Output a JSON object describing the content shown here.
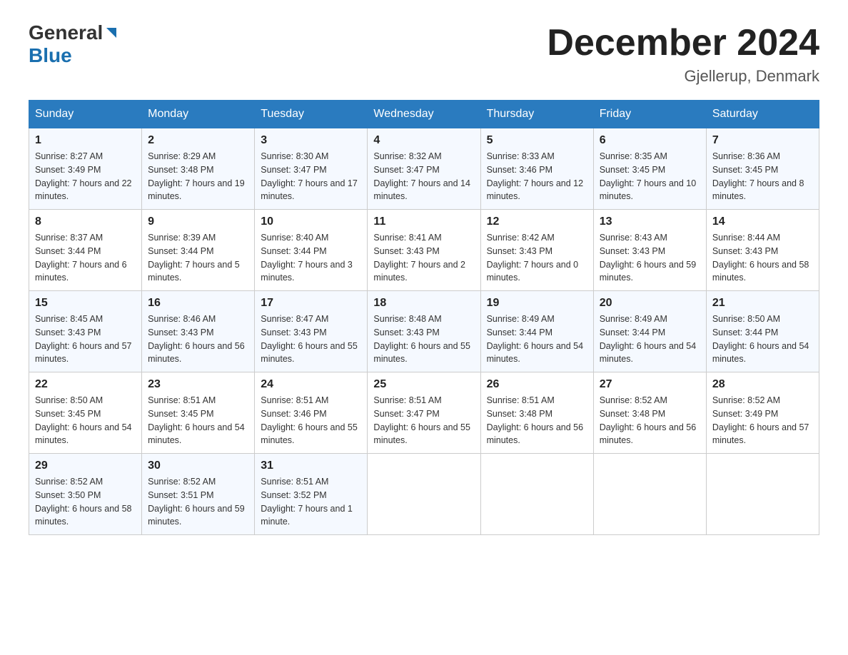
{
  "logo": {
    "general": "General",
    "blue": "Blue"
  },
  "header": {
    "title": "December 2024",
    "subtitle": "Gjellerup, Denmark"
  },
  "days_of_week": [
    "Sunday",
    "Monday",
    "Tuesday",
    "Wednesday",
    "Thursday",
    "Friday",
    "Saturday"
  ],
  "weeks": [
    [
      {
        "day": "1",
        "sunrise": "8:27 AM",
        "sunset": "3:49 PM",
        "daylight": "7 hours and 22 minutes."
      },
      {
        "day": "2",
        "sunrise": "8:29 AM",
        "sunset": "3:48 PM",
        "daylight": "7 hours and 19 minutes."
      },
      {
        "day": "3",
        "sunrise": "8:30 AM",
        "sunset": "3:47 PM",
        "daylight": "7 hours and 17 minutes."
      },
      {
        "day": "4",
        "sunrise": "8:32 AM",
        "sunset": "3:47 PM",
        "daylight": "7 hours and 14 minutes."
      },
      {
        "day": "5",
        "sunrise": "8:33 AM",
        "sunset": "3:46 PM",
        "daylight": "7 hours and 12 minutes."
      },
      {
        "day": "6",
        "sunrise": "8:35 AM",
        "sunset": "3:45 PM",
        "daylight": "7 hours and 10 minutes."
      },
      {
        "day": "7",
        "sunrise": "8:36 AM",
        "sunset": "3:45 PM",
        "daylight": "7 hours and 8 minutes."
      }
    ],
    [
      {
        "day": "8",
        "sunrise": "8:37 AM",
        "sunset": "3:44 PM",
        "daylight": "7 hours and 6 minutes."
      },
      {
        "day": "9",
        "sunrise": "8:39 AM",
        "sunset": "3:44 PM",
        "daylight": "7 hours and 5 minutes."
      },
      {
        "day": "10",
        "sunrise": "8:40 AM",
        "sunset": "3:44 PM",
        "daylight": "7 hours and 3 minutes."
      },
      {
        "day": "11",
        "sunrise": "8:41 AM",
        "sunset": "3:43 PM",
        "daylight": "7 hours and 2 minutes."
      },
      {
        "day": "12",
        "sunrise": "8:42 AM",
        "sunset": "3:43 PM",
        "daylight": "7 hours and 0 minutes."
      },
      {
        "day": "13",
        "sunrise": "8:43 AM",
        "sunset": "3:43 PM",
        "daylight": "6 hours and 59 minutes."
      },
      {
        "day": "14",
        "sunrise": "8:44 AM",
        "sunset": "3:43 PM",
        "daylight": "6 hours and 58 minutes."
      }
    ],
    [
      {
        "day": "15",
        "sunrise": "8:45 AM",
        "sunset": "3:43 PM",
        "daylight": "6 hours and 57 minutes."
      },
      {
        "day": "16",
        "sunrise": "8:46 AM",
        "sunset": "3:43 PM",
        "daylight": "6 hours and 56 minutes."
      },
      {
        "day": "17",
        "sunrise": "8:47 AM",
        "sunset": "3:43 PM",
        "daylight": "6 hours and 55 minutes."
      },
      {
        "day": "18",
        "sunrise": "8:48 AM",
        "sunset": "3:43 PM",
        "daylight": "6 hours and 55 minutes."
      },
      {
        "day": "19",
        "sunrise": "8:49 AM",
        "sunset": "3:44 PM",
        "daylight": "6 hours and 54 minutes."
      },
      {
        "day": "20",
        "sunrise": "8:49 AM",
        "sunset": "3:44 PM",
        "daylight": "6 hours and 54 minutes."
      },
      {
        "day": "21",
        "sunrise": "8:50 AM",
        "sunset": "3:44 PM",
        "daylight": "6 hours and 54 minutes."
      }
    ],
    [
      {
        "day": "22",
        "sunrise": "8:50 AM",
        "sunset": "3:45 PM",
        "daylight": "6 hours and 54 minutes."
      },
      {
        "day": "23",
        "sunrise": "8:51 AM",
        "sunset": "3:45 PM",
        "daylight": "6 hours and 54 minutes."
      },
      {
        "day": "24",
        "sunrise": "8:51 AM",
        "sunset": "3:46 PM",
        "daylight": "6 hours and 55 minutes."
      },
      {
        "day": "25",
        "sunrise": "8:51 AM",
        "sunset": "3:47 PM",
        "daylight": "6 hours and 55 minutes."
      },
      {
        "day": "26",
        "sunrise": "8:51 AM",
        "sunset": "3:48 PM",
        "daylight": "6 hours and 56 minutes."
      },
      {
        "day": "27",
        "sunrise": "8:52 AM",
        "sunset": "3:48 PM",
        "daylight": "6 hours and 56 minutes."
      },
      {
        "day": "28",
        "sunrise": "8:52 AM",
        "sunset": "3:49 PM",
        "daylight": "6 hours and 57 minutes."
      }
    ],
    [
      {
        "day": "29",
        "sunrise": "8:52 AM",
        "sunset": "3:50 PM",
        "daylight": "6 hours and 58 minutes."
      },
      {
        "day": "30",
        "sunrise": "8:52 AM",
        "sunset": "3:51 PM",
        "daylight": "6 hours and 59 minutes."
      },
      {
        "day": "31",
        "sunrise": "8:51 AM",
        "sunset": "3:52 PM",
        "daylight": "7 hours and 1 minute."
      },
      null,
      null,
      null,
      null
    ]
  ]
}
